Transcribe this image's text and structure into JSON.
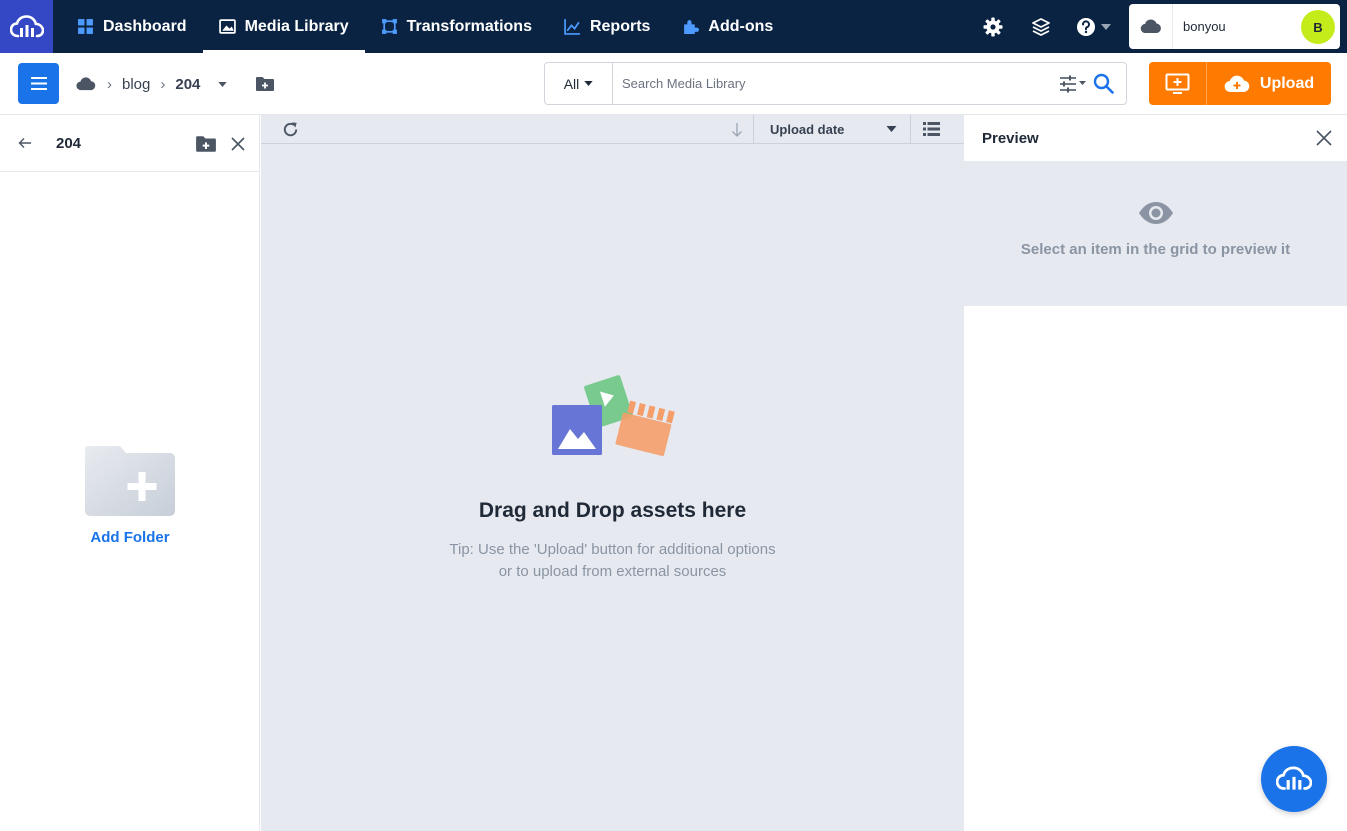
{
  "app": {
    "name": "Cloudinary"
  },
  "topnav": {
    "items": [
      {
        "label": "Dashboard",
        "icon": "dashboard-icon"
      },
      {
        "label": "Media Library",
        "icon": "media-library-icon",
        "active": true
      },
      {
        "label": "Transformations",
        "icon": "transformations-icon"
      },
      {
        "label": "Reports",
        "icon": "reports-icon"
      },
      {
        "label": "Add-ons",
        "icon": "add-ons-icon"
      }
    ],
    "right_icons": [
      "gear-icon",
      "layers-icon",
      "help-icon"
    ],
    "account": {
      "name": "bonyou",
      "avatar_initial": "B",
      "avatar_color": "#c4ec1a"
    }
  },
  "toolbar": {
    "breadcrumb": [
      "blog",
      "204"
    ],
    "search": {
      "type": "All",
      "placeholder": "Search Media Library"
    },
    "upload_label": "Upload"
  },
  "folder_panel": {
    "title": "204",
    "add_folder_label": "Add Folder"
  },
  "grid": {
    "sort_by": "Upload date",
    "empty_title": "Drag and Drop assets here",
    "empty_tip_line1": "Tip: Use the 'Upload' button for additional options",
    "empty_tip_line2": "or to upload from external sources"
  },
  "preview": {
    "title": "Preview",
    "hint": "Select an item in the grid to preview it"
  },
  "colors": {
    "nav_bg": "#0b2343",
    "logo_bg": "#3448c5",
    "accent_blue": "#1a73e8",
    "upload_orange": "#ff7a00",
    "panel_gray": "#e6eaf0"
  }
}
